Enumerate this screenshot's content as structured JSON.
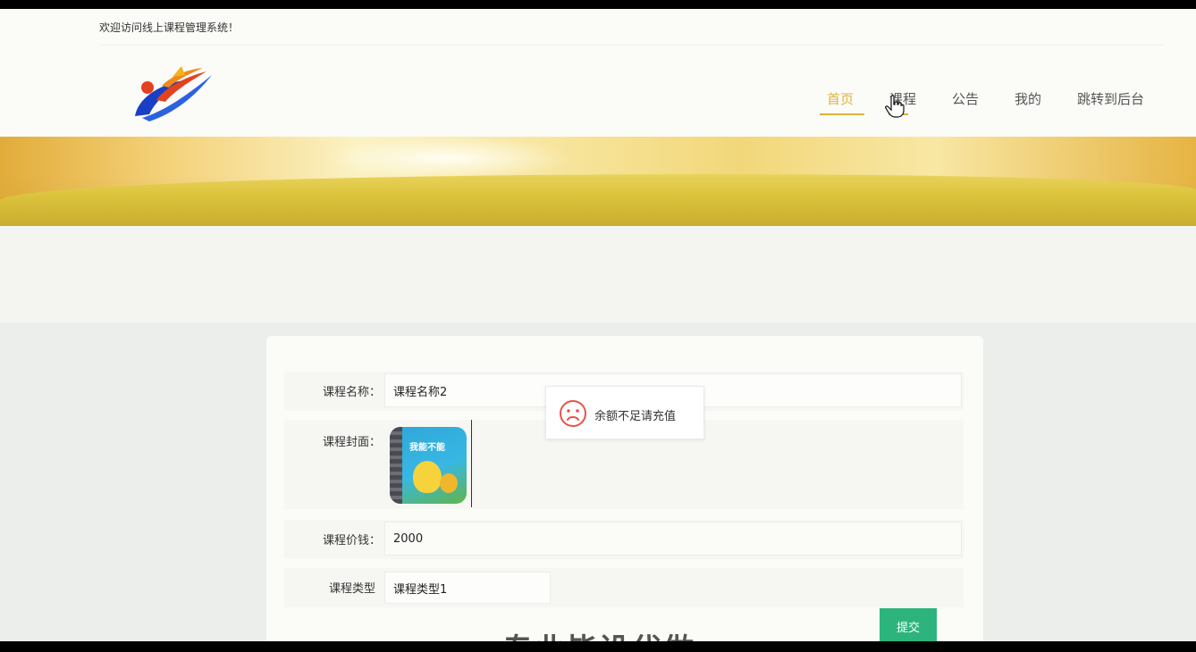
{
  "header": {
    "welcome": "欢迎访问线上课程管理系统！",
    "logo_icon": "site-logo-icon"
  },
  "nav": {
    "items": [
      {
        "label": "首页",
        "active": true
      },
      {
        "label": "课程",
        "active": false
      },
      {
        "label": "公告",
        "active": false
      },
      {
        "label": "我的",
        "active": false
      },
      {
        "label": "跳转到后台",
        "active": false
      }
    ],
    "accent_color": "#e2b13c"
  },
  "form": {
    "course_name": {
      "label": "课程名称：",
      "value": "课程名称2"
    },
    "course_cover": {
      "label": "课程封面：",
      "image_text": "我能不能"
    },
    "course_price": {
      "label": "课程价钱：",
      "value": "2000"
    },
    "course_type": {
      "label": "课程类型",
      "value": "课程类型1"
    },
    "submit_label": "提交",
    "submit_color": "#2db47d"
  },
  "toast": {
    "icon": "sad-face-icon",
    "message": "余额不足请充值",
    "icon_color": "#e5544b"
  },
  "watermark": {
    "text": "专业毕设代做"
  }
}
